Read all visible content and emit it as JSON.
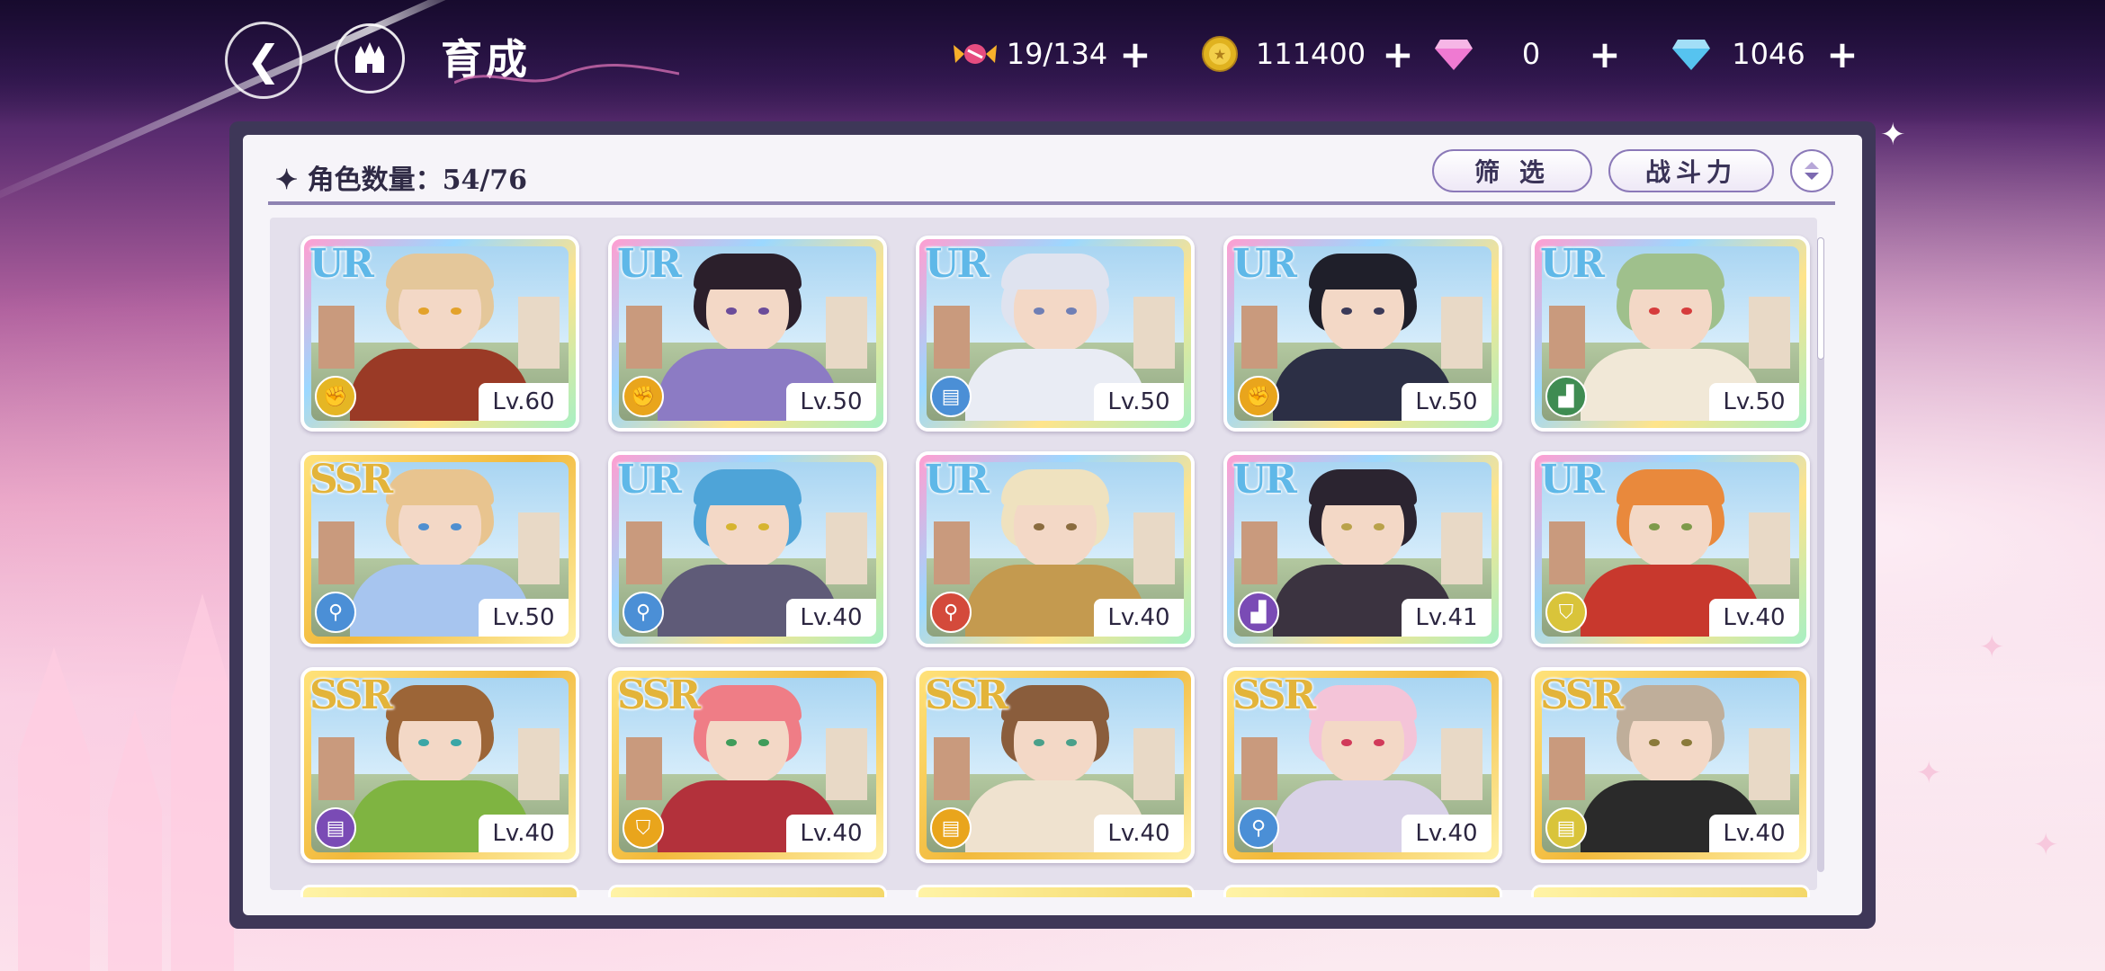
{
  "header": {
    "title": "育成",
    "back_icon": "back-arrow-icon",
    "home_icon": "castle-home-icon"
  },
  "resources": [
    {
      "name": "candy",
      "icon": "candy-icon",
      "value": "19/134",
      "color": "#e64d80"
    },
    {
      "name": "coin",
      "icon": "gold-coin-icon",
      "value": "111400",
      "color": "#e0b21f"
    },
    {
      "name": "pink-gem",
      "icon": "pink-diamond-icon",
      "value": "0",
      "color": "#ef7ad2"
    },
    {
      "name": "blue-gem",
      "icon": "blue-diamond-icon",
      "value": "1046",
      "color": "#56c3f0"
    }
  ],
  "panel": {
    "count_label": "角色数量：54/76",
    "filter_label": "筛 选",
    "sort_label": "战斗力"
  },
  "cards": [
    {
      "rarity": "UR",
      "level": "Lv.60",
      "role_color": "#e5b624",
      "role_icon": "fist-icon",
      "hair": "#e4c79a",
      "outfit": "#9a3a26",
      "eyes": "#e3a22a"
    },
    {
      "rarity": "UR",
      "level": "Lv.50",
      "role_color": "#e9a51c",
      "role_icon": "fist-icon",
      "hair": "#2b1f2b",
      "outfit": "#8c7bc4",
      "eyes": "#6b4c9a"
    },
    {
      "rarity": "UR",
      "level": "Lv.50",
      "role_color": "#4b8fd6",
      "role_icon": "book-icon",
      "hair": "#dfe3ef",
      "outfit": "#e9ecf4",
      "eyes": "#6f7fb5"
    },
    {
      "rarity": "UR",
      "level": "Lv.50",
      "role_color": "#e9a51c",
      "role_icon": "fist-icon",
      "hair": "#1f1f2a",
      "outfit": "#2c2f45",
      "eyes": "#3b3a58"
    },
    {
      "rarity": "UR",
      "level": "Lv.50",
      "role_color": "#3f8c52",
      "role_icon": "boot-icon",
      "hair": "#9fc08c",
      "outfit": "#f1e8d7",
      "eyes": "#d63c3c"
    },
    {
      "rarity": "SSR",
      "level": "Lv.50",
      "role_color": "#4b8fd6",
      "role_icon": "staff-icon",
      "hair": "#e8c48f",
      "outfit": "#a7c5ef",
      "eyes": "#4f8fd0"
    },
    {
      "rarity": "UR",
      "level": "Lv.40",
      "role_color": "#4b8fd6",
      "role_icon": "staff-icon",
      "hair": "#4ea4d8",
      "outfit": "#5f5b78",
      "eyes": "#d6b430"
    },
    {
      "rarity": "UR",
      "level": "Lv.40",
      "role_color": "#d44a3b",
      "role_icon": "staff-icon",
      "hair": "#efe2bf",
      "outfit": "#c49a4f",
      "eyes": "#8a6c3f"
    },
    {
      "rarity": "UR",
      "level": "Lv.41",
      "role_color": "#7a4bb5",
      "role_icon": "boot-icon",
      "hair": "#2b2430",
      "outfit": "#3b3340",
      "eyes": "#b9a24a"
    },
    {
      "rarity": "UR",
      "level": "Lv.40",
      "role_color": "#d9c43a",
      "role_icon": "shield-icon",
      "hair": "#e9893c",
      "outfit": "#c8382d",
      "eyes": "#7d9a4a"
    },
    {
      "rarity": "SSR",
      "level": "Lv.40",
      "role_color": "#7a4bb5",
      "role_icon": "book-icon",
      "hair": "#9c6537",
      "outfit": "#7fb441",
      "eyes": "#3aa6a6"
    },
    {
      "rarity": "SSR",
      "level": "Lv.40",
      "role_color": "#e9a51c",
      "role_icon": "shield-icon",
      "hair": "#ef7d86",
      "outfit": "#b3313b",
      "eyes": "#3f9c5a"
    },
    {
      "rarity": "SSR",
      "level": "Lv.40",
      "role_color": "#e9a51c",
      "role_icon": "book-icon",
      "hair": "#8a5d3c",
      "outfit": "#efe2cf",
      "eyes": "#4aa08a"
    },
    {
      "rarity": "SSR",
      "level": "Lv.40",
      "role_color": "#4b8fd6",
      "role_icon": "staff-icon",
      "hair": "#f4c4d8",
      "outfit": "#d9d2e8",
      "eyes": "#d13a5a"
    },
    {
      "rarity": "SSR",
      "level": "Lv.40",
      "role_color": "#d9c43a",
      "role_icon": "book-icon",
      "hair": "#bfae9a",
      "outfit": "#2a2a2a",
      "eyes": "#8a7a3a"
    }
  ]
}
